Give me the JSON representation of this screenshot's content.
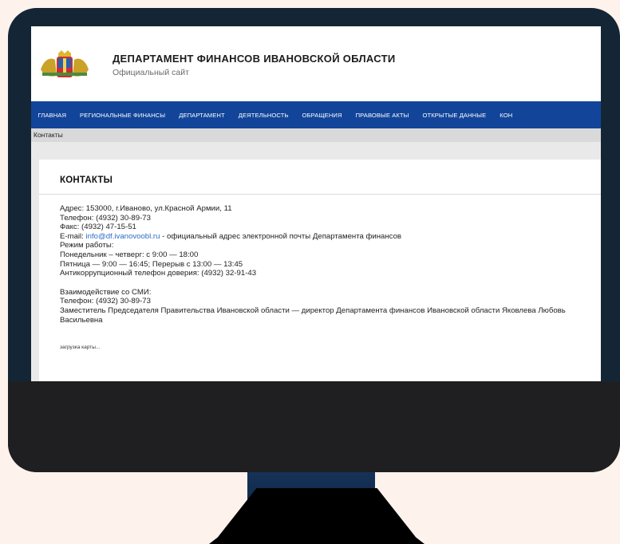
{
  "header": {
    "title": "ДЕПАРТАМЕНТ ФИНАНСОВ ИВАНОВСКОЙ ОБЛАСТИ",
    "subtitle": "Официальный сайт"
  },
  "nav": {
    "items": [
      "ГЛАВНАЯ",
      "РЕГИОНАЛЬНЫЕ ФИНАНСЫ",
      "ДЕПАРТАМЕНТ",
      "ДЕЯТЕЛЬНОСТЬ",
      "ОБРАЩЕНИЯ",
      "ПРАВОВЫЕ АКТЫ",
      "ОТКРЫТЫЕ ДАННЫЕ",
      "КОН"
    ]
  },
  "breadcrumb": "Контакты",
  "page": {
    "title": "КОНТАКТЫ",
    "address": "Адрес: 153000, г.Иваново, ул.Красной Армии, 11",
    "phone": "Телефон: (4932) 30-89-73",
    "fax": "Факс: (4932) 47-15-51",
    "email_label": "E-mail: ",
    "email": "info@df.ivanovoobl.ru",
    "email_note": " - официальный адрес электронной почты  Департамента финансов",
    "schedule_label": "Режим работы:",
    "schedule_mon_thu": "Понедельник – четверг: с 9:00 — 18:00",
    "schedule_fri": "Пятница — 9:00 — 16:45; Перерыв с 13:00 — 13:45",
    "anticorruption": "Антикоррупционный телефон доверия: (4932) 32-91-43",
    "media_label": "Взаимодействие со СМИ:",
    "media_phone": "Телефон: (4932) 30-89-73",
    "media_person": "Заместитель Председателя Правительства Ивановской области — директор Департамента финансов Ивановской области  Яковлева Любовь Васильевна",
    "map_loading": "загрузка карты..."
  },
  "colors": {
    "nav": "#12459a",
    "monitor_frame": "#142636",
    "monitor_chin": "#1f1f21",
    "link": "#2b6cc4"
  }
}
